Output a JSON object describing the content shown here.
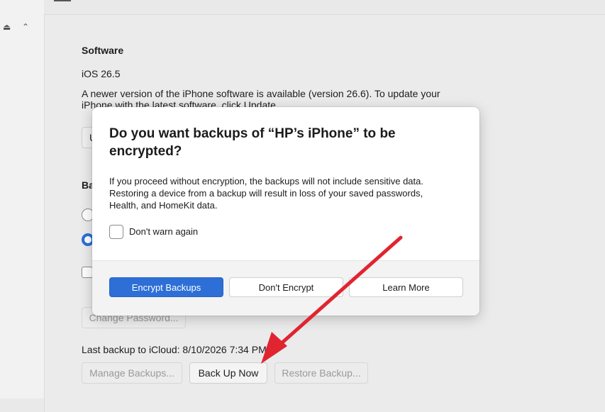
{
  "window": {
    "eject_icon": "eject-icon",
    "collapse_icon": "chevron-up-icon"
  },
  "software": {
    "title": "Software",
    "version": "iOS 26.5",
    "update_line1": "A newer version of the iPhone software is available (version 26.6). To update your",
    "update_line2": "iPhone with the latest software, click Update.",
    "update_button_partial": "U"
  },
  "backups": {
    "title_partial": "Ba",
    "change_password_label": "Change Password...",
    "last_backup": "Last backup to iCloud: 8/10/2026 7:34 PM",
    "manage_label": "Manage Backups...",
    "backup_now_label": "Back Up Now",
    "restore_label": "Restore Backup..."
  },
  "modal": {
    "title_line1": "Do you want backups of “HP’s iPhone” to be",
    "title_line2": "encrypted?",
    "body_line1": "If you proceed without encryption, the backups will not include sensitive data.",
    "body_line2": "Restoring a device from a backup will result in loss of your saved passwords,",
    "body_line3": "Health, and HomeKit data.",
    "dont_warn_label": "Don't warn again",
    "encrypt_label": "Encrypt Backups",
    "dont_encrypt_label": "Don't Encrypt",
    "learn_more_label": "Learn More"
  },
  "colors": {
    "accent": "#2d6fd6",
    "annotation_arrow": "#e02530"
  }
}
